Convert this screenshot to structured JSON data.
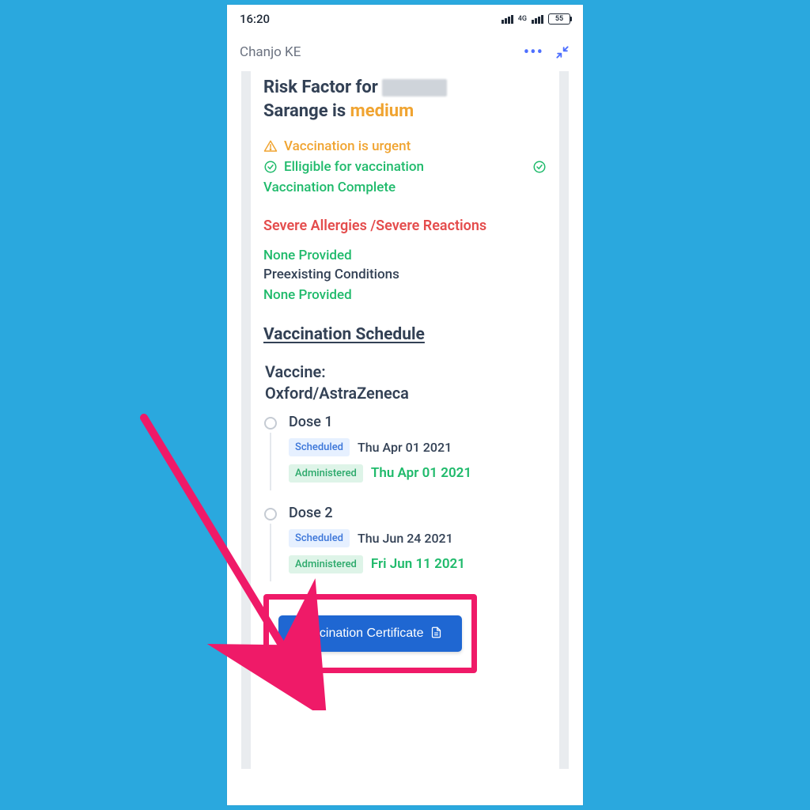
{
  "status_bar": {
    "time": "16:20",
    "network": "4G",
    "battery": "55"
  },
  "app_header": {
    "title": "Chanjo KE"
  },
  "risk": {
    "prefix": "Risk Factor for ",
    "name_hidden": true,
    "name_line2": "Sarange is ",
    "level": "medium"
  },
  "status_items": {
    "urgent": "Vaccination is urgent",
    "eligible": "Elligible for vaccination",
    "complete": "Vaccination Complete"
  },
  "allergies": {
    "heading_a": "Severe Allergies ",
    "sep": "/",
    "heading_b": "Severe Reactions",
    "value": "None Provided"
  },
  "conditions": {
    "label": "Preexisting Conditions",
    "value": "None Provided"
  },
  "schedule": {
    "title": "Vaccination Schedule",
    "vaccine_label": "Vaccine:",
    "vaccine_name": "Oxford/AstraZeneca",
    "pill_scheduled": "Scheduled",
    "pill_administered": "Administered",
    "doses": [
      {
        "title": "Dose 1",
        "scheduled_date": "Thu Apr 01 2021",
        "administered_date": "Thu Apr 01 2021"
      },
      {
        "title": "Dose 2",
        "scheduled_date": "Thu Jun 24 2021",
        "administered_date": "Fri Jun 11 2021"
      }
    ]
  },
  "certificate_button": "Vaccination Certificate"
}
